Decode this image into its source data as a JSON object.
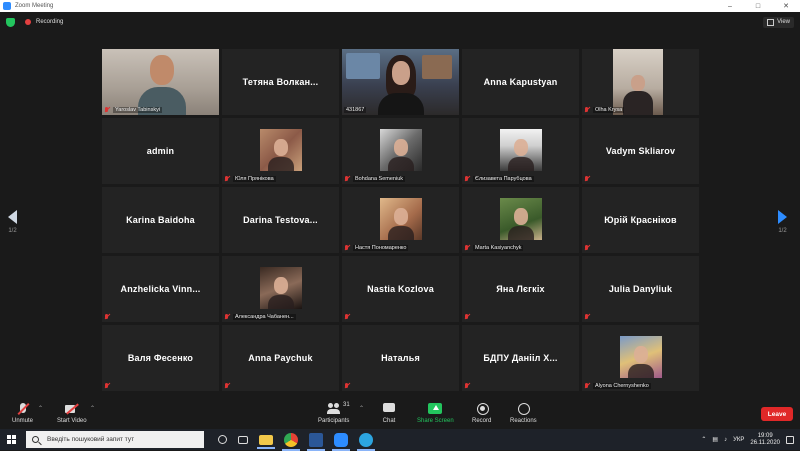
{
  "window": {
    "title": "Zoom Meeting"
  },
  "top": {
    "recording_label": "Recording",
    "view_label": "View"
  },
  "pager": {
    "left_page": "1/2",
    "right_page": "1/2"
  },
  "tiles": [
    {
      "name": "Yaroslav Tabinskyi",
      "type": "video",
      "muted": true
    },
    {
      "name": "Тетяна  Волкан...",
      "type": "name",
      "muted": false
    },
    {
      "name": "431867",
      "type": "video",
      "muted": false,
      "active": true
    },
    {
      "name": "Anna Kapustyan",
      "type": "name",
      "muted": false
    },
    {
      "name": "Olha Krysa",
      "type": "video",
      "muted": true
    },
    {
      "name": "admin",
      "type": "name",
      "muted": false
    },
    {
      "name": "Юля Прянікова",
      "type": "photo",
      "muted": true
    },
    {
      "name": "Bohdana Semeniuk",
      "type": "photo",
      "muted": true
    },
    {
      "name": "Єлизавета Парубцова",
      "type": "photo",
      "muted": true
    },
    {
      "name": "Vadym Skliarov",
      "type": "name",
      "muted": true
    },
    {
      "name": "Karina Baidoha",
      "type": "name",
      "muted": false
    },
    {
      "name": "Darina  Testova...",
      "type": "name",
      "muted": false
    },
    {
      "name": "Настя Пономаренко",
      "type": "photo",
      "muted": true
    },
    {
      "name": "Marta Kasiyanchyk",
      "type": "photo",
      "muted": true
    },
    {
      "name": "Юрій Красніков",
      "type": "name",
      "muted": true
    },
    {
      "name": "Anzhelicka  Vinn...",
      "type": "name",
      "muted": true
    },
    {
      "name": "Александра Чабанен...",
      "type": "photo",
      "muted": true
    },
    {
      "name": "Nastia Kozlova",
      "type": "name",
      "muted": true
    },
    {
      "name": "Яна Лєгкіх",
      "type": "name",
      "muted": true
    },
    {
      "name": "Julia Danyliuk",
      "type": "name",
      "muted": true
    },
    {
      "name": "Валя Фесенко",
      "type": "name",
      "muted": true
    },
    {
      "name": "Anna Paychuk",
      "type": "name",
      "muted": true
    },
    {
      "name": "Наталья",
      "type": "name",
      "muted": true
    },
    {
      "name": "БДПУ Данііл Х...",
      "type": "name",
      "muted": true
    },
    {
      "name": "Alyona Chernyshenko",
      "type": "photo",
      "muted": true
    }
  ],
  "toolbar": {
    "unmute": "Unmute",
    "start_video": "Start Video",
    "participants": "Participants",
    "participants_count": "31",
    "chat": "Chat",
    "share_screen": "Share Screen",
    "record": "Record",
    "reactions": "Reactions",
    "leave": "Leave"
  },
  "taskbar": {
    "search_placeholder": "Введіть пошуковий запит тут",
    "language": "УКР",
    "time": "19:09",
    "date": "26.11.2020"
  }
}
